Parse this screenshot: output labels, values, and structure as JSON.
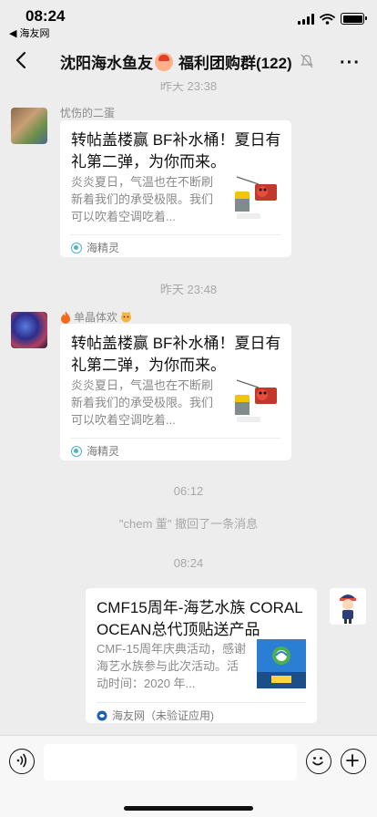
{
  "status": {
    "time": "08:24",
    "back_app": "◀ 海友网"
  },
  "nav": {
    "title": "沈阳海水鱼友",
    "title_rest": "福利团购群(122)",
    "more": "···"
  },
  "messages": {
    "ts1": "昨天 23:38",
    "m1": {
      "sender": "忧伤的二蛋",
      "title": "转帖盖楼赢 BF补水桶！夏日有礼第二弹，为你而来。",
      "desc": "炎炎夏日，气温也在不断刷新着我们的承受极限。我们可以吹着空调吃着...",
      "source": "海精灵"
    },
    "ts2": "昨天 23:48",
    "m2": {
      "sender": "单晶体欢",
      "title": "转帖盖楼赢 BF补水桶！夏日有礼第二弹，为你而来。",
      "desc": "炎炎夏日，气温也在不断刷新着我们的承受极限。我们可以吹着空调吃着...",
      "source": "海精灵"
    },
    "ts3": "06:12",
    "system": "\"chem 董\" 撤回了一条消息",
    "ts4": "08:24",
    "m3": {
      "title": "CMF15周年-海艺水族 CORAL OCEAN总代顶贴送产品",
      "desc": "CMF-15周年庆典活动，感谢海艺水族参与此次活动。活动时间：2020 年...",
      "source": "海友网（未验证应用)"
    }
  },
  "input": {
    "placeholder": ""
  }
}
